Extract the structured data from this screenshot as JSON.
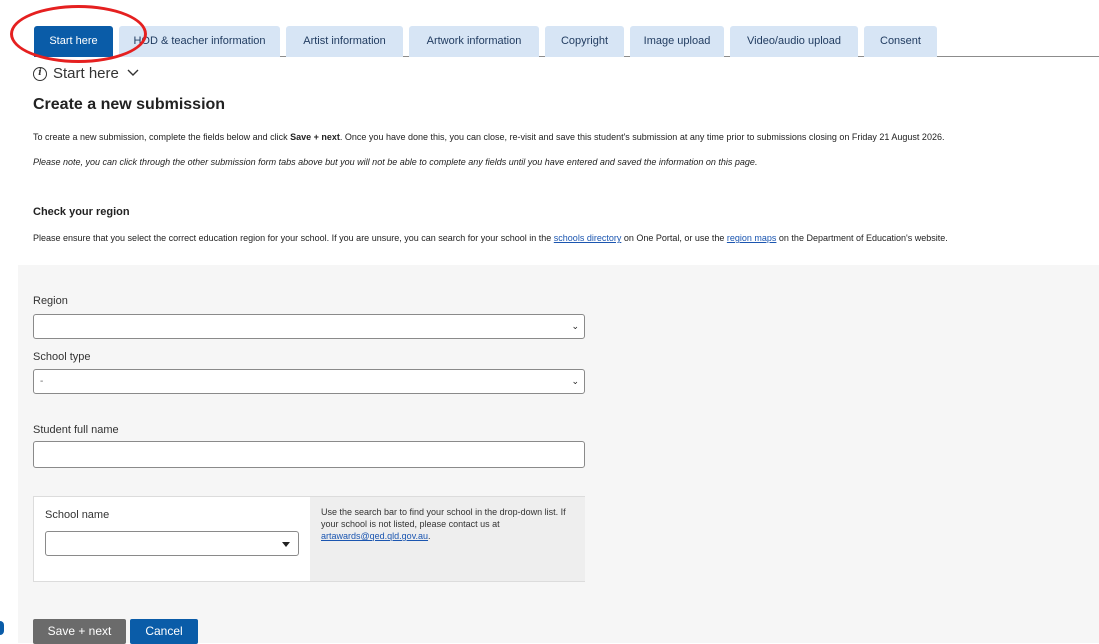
{
  "tabs": [
    {
      "label": "Start here",
      "active": true
    },
    {
      "label": "HOD & teacher information"
    },
    {
      "label": "Artist information"
    },
    {
      "label": "Artwork information"
    },
    {
      "label": "Copyright"
    },
    {
      "label": "Image upload"
    },
    {
      "label": "Video/audio upload"
    },
    {
      "label": "Consent"
    }
  ],
  "section": {
    "title": "Start here",
    "icon": "info-icon",
    "toggle_icon": "chevron-down-icon"
  },
  "heading": "Create a new submission",
  "intro": {
    "before": "To create a new submission, complete the fields below and click ",
    "bold": "Save + next",
    "after": ". Once you have done this, you can close, re-visit and save this student's submission at any time prior to submissions closing on Friday 21 August 2026."
  },
  "note": "Please note, you can click through the other submission form tabs above but you will not be able to complete any fields until you have entered and saved the information on this page.",
  "region_check": {
    "heading": "Check your region",
    "text_before": "Please ensure that you select the correct education region for your school. If you are unsure, you can search for your school in the ",
    "link1": "schools directory",
    "text_middle": " on One Portal, or use the ",
    "link2": "region maps",
    "text_after": " on the Department of Education's website."
  },
  "form": {
    "region_label": "Region",
    "region_value": "",
    "school_type_label": "School type",
    "school_type_value": "-",
    "student_name_label": "Student full name",
    "student_name_value": "",
    "school_name_label": "School name",
    "school_name_value": "",
    "school_help_text": "Use the search bar to find your school in the drop-down list. If your school is not listed, please contact us at ",
    "school_help_email": "artawards@qed.qld.gov.au",
    "school_help_end": "."
  },
  "buttons": {
    "save": "Save + next",
    "cancel": "Cancel"
  },
  "colors": {
    "accent": "#0a5ca8",
    "tab_inactive": "#d7e5f5",
    "highlight": "#e52020",
    "panel": "#f6f6f6"
  }
}
